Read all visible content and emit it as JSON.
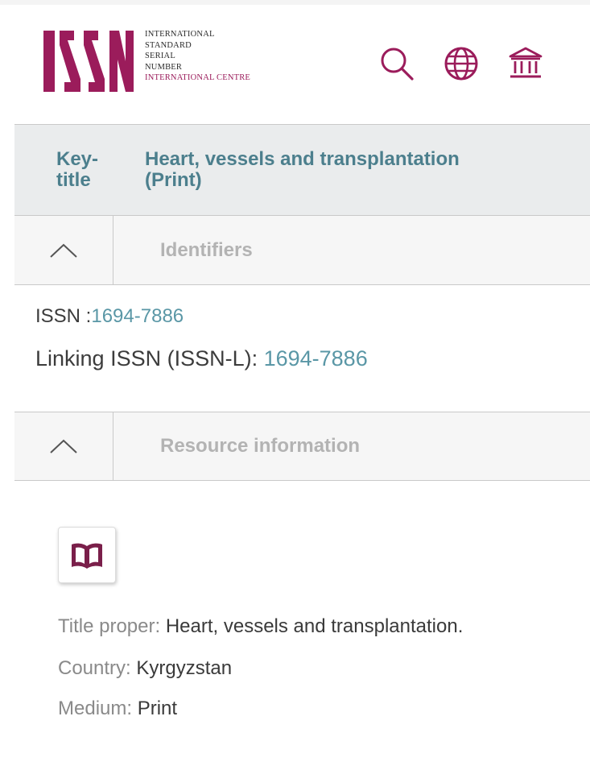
{
  "header": {
    "logo_letters": "ISSN",
    "logo_lines": [
      "INTERNATIONAL",
      "STANDARD",
      "SERIAL",
      "NUMBER"
    ],
    "logo_centre": "INTERNATIONAL CENTRE",
    "icons": [
      "search-icon",
      "globe-icon",
      "institution-icon"
    ]
  },
  "key_title": {
    "label_line1": "Key-",
    "label_line2": "title",
    "value_line1": "Heart, vessels and transplantation",
    "value_line2": "(Print)"
  },
  "identifiers": {
    "section_title": "Identifiers",
    "issn_label": "ISSN :",
    "issn_value": "1694-7886",
    "issnl_label": "Linking ISSN (ISSN-L): ",
    "issnl_value": "1694-7886"
  },
  "resource": {
    "section_title": "Resource information",
    "title_proper_label": "Title proper: ",
    "title_proper_value": "Heart, vessels and transplantation.",
    "country_label": "Country: ",
    "country_value": "Kyrgyzstan",
    "medium_label": "Medium: ",
    "medium_value": "Print"
  },
  "colors": {
    "brand": "#9b1c5b",
    "link": "#5a97a6",
    "key_title": "#4c7f8d"
  }
}
